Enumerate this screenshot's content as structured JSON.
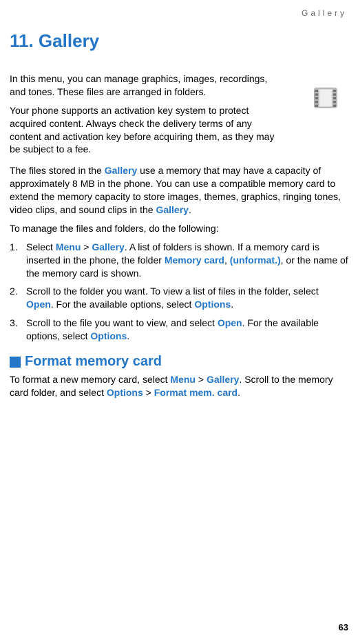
{
  "header": "Gallery",
  "chapterTitle": "11. Gallery",
  "intro1": "In this menu, you can manage graphics, images, recordings, and tones. These files are arranged in folders.",
  "intro2": "Your phone supports an activation key system to protect acquired content. Always check the delivery terms of any content and activation key before acquiring them, as they may be subject to a fee.",
  "memoryP_1": "The files stored in the ",
  "memoryP_2": " use a memory that may have a capacity of approximately 8 MB in the phone. You can use a compatible memory card to extend the memory capacity to store images, themes, graphics, ringing tones, video clips, and sound clips in the ",
  "memoryP_3": ".",
  "manageLead": "To manage the files and folders, do the following:",
  "li1_select": "Select ",
  "li1_after": ". A list of folders is shown. If a memory card is inserted in the phone, the folder ",
  "li1_tail": ", or the name of the memory card is shown.",
  "li2_a": "Scroll to the folder you want. To view a list of files in the folder, select ",
  "li2_b": ". For the available options, select ",
  "li2_c": ".",
  "li3_a": "Scroll to the file you want to view, and select ",
  "li3_b": ". For the available options, select ",
  "li3_c": ".",
  "sectionTitle": "Format memory card",
  "format_a": "To format a new memory card, select ",
  "format_b": ". Scroll to the memory card folder, and select ",
  "format_c": ".",
  "hl": {
    "gallery": "Gallery",
    "menu": "Menu",
    "gt": " > ",
    "memoryCard": "Memory card",
    "comma": ", ",
    "unformat": "(unformat.)",
    "open": "Open",
    "options": "Options",
    "formatMem": "Format mem. card"
  },
  "pageNumber": "63"
}
